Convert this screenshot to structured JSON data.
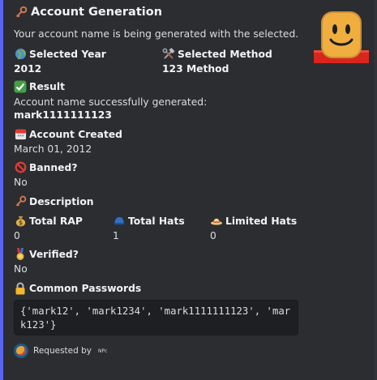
{
  "embed": {
    "title": "Account Generation",
    "title_icon": "key-icon",
    "description": "Your account name is being generated with the selected.",
    "fields": {
      "year": {
        "name": "Selected Year",
        "value": "2012",
        "icon": "globe-icon"
      },
      "method": {
        "name": "Selected Method",
        "value": "123 Method",
        "icon": "hammer-wrench-icon"
      },
      "result": {
        "name": "Result",
        "line1": "Account name successfully generated:",
        "line2": "mark1111111123",
        "icon": "check-icon"
      },
      "created": {
        "name": "Account Created",
        "value": "March 01, 2012",
        "icon": "calendar-icon"
      },
      "banned": {
        "name": "Banned?",
        "value": "No",
        "icon": "prohibited-icon"
      },
      "description": {
        "name": "Description",
        "icon": "key-icon"
      },
      "rap": {
        "name": "Total RAP",
        "value": "0",
        "icon": "money-bag-icon"
      },
      "hats": {
        "name": "Total Hats",
        "value": "1",
        "icon": "blue-cap-icon"
      },
      "limited": {
        "name": "Limited Hats",
        "value": "0",
        "icon": "hat-icon"
      },
      "verified": {
        "name": "Verified?",
        "value": "No",
        "icon": "medal-icon"
      },
      "passwords": {
        "name": "Common Passwords",
        "value": "{'mark12', 'mark1234', 'mark1111111123', 'mark123'}",
        "icon": "lock-icon"
      }
    },
    "footer": {
      "text": "Requested by",
      "user": "NPc"
    },
    "thumbnail": "roblox-noob-face",
    "accent_color": "#5865f2"
  }
}
